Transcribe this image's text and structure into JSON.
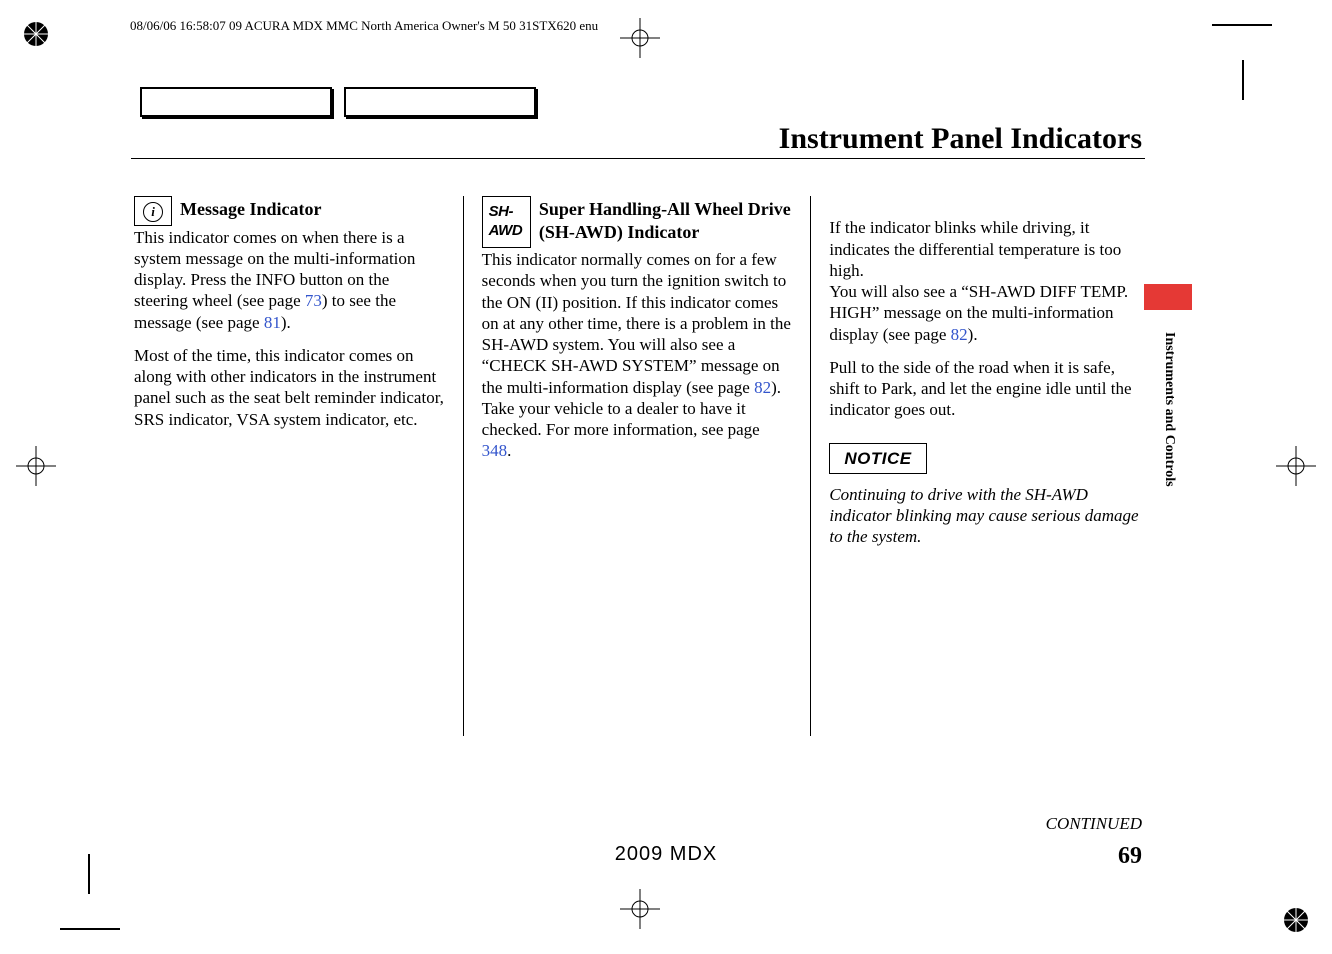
{
  "header_stamp": "08/06/06 16:58:07   09 ACURA MDX MMC North America Owner's M 50 31STX620 enu",
  "page_title": "Instrument Panel Indicators",
  "side_label": "Instruments and Controls",
  "col1": {
    "icon_alt": "i",
    "heading": "Message Indicator",
    "p1a": "This indicator comes on when there is a system message on the multi-information display. Press the INFO button on the steering wheel (see page ",
    "p1_link1": "73",
    "p1b": ") to see the message (see page ",
    "p1_link2": "81",
    "p1c": ").",
    "p2": "Most of the time, this indicator comes on along with other indicators in the instrument panel such as the seat belt reminder indicator, SRS indicator, VSA system indicator, etc."
  },
  "col2": {
    "icon_text": "SH-AWD",
    "heading": "Super Handling-All Wheel Drive (SH-AWD) Indicator",
    "p1a": "This indicator normally comes on for a few seconds when you turn the ignition switch to the ON (II) position. If this indicator comes on at any other time, there is a problem in the SH-AWD system. You will also see a “CHECK SH-AWD SYSTEM” message on the multi-information display (see page ",
    "p1_link1": "82",
    "p1b": "). Take your vehicle to a dealer to have it checked. For more information, see page ",
    "p1_link2": "348",
    "p1c": "."
  },
  "col3": {
    "p1a": "If the indicator blinks while driving, it indicates the differential temperature is too high.\nYou will also see a “SH-AWD DIFF TEMP. HIGH” message on the multi-information display (see page ",
    "p1_link1": "82",
    "p1b": ").",
    "p2": "Pull to the side of the road when it is safe, shift to Park, and let the engine idle until the indicator goes out.",
    "notice_label": "NOTICE",
    "notice_text": "Continuing to drive with the SH-AWD indicator blinking may cause serious damage to the system."
  },
  "continued": "CONTINUED",
  "footer_model": "2009  MDX",
  "page_number": "69"
}
